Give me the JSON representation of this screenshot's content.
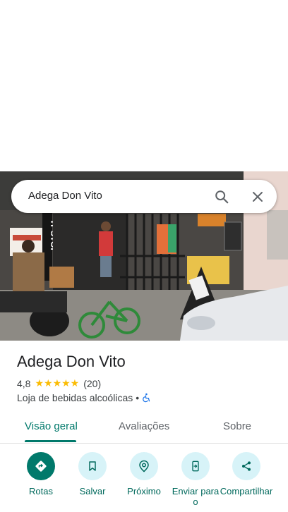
{
  "search": {
    "query": "Adega Don Vito"
  },
  "place": {
    "name": "Adega Don Vito",
    "rating": "4,8",
    "stars": "★★★★★",
    "review_count": "(20)",
    "category": "Loja de bebidas alcoólicas",
    "separator": "•"
  },
  "tabs": [
    {
      "label": "Visão geral",
      "active": true
    },
    {
      "label": "Avaliações",
      "active": false
    },
    {
      "label": "Sobre",
      "active": false
    }
  ],
  "actions": [
    {
      "label": "Rotas",
      "icon": "directions-icon"
    },
    {
      "label": "Salvar",
      "icon": "bookmark-icon"
    },
    {
      "label": "Próximo",
      "icon": "nearby-icon"
    },
    {
      "label": "Enviar para o",
      "icon": "send-to-phone-icon"
    },
    {
      "label": "Compartilhar",
      "icon": "share-icon"
    }
  ],
  "photo": {
    "sign_text": "IT STOP"
  },
  "colors": {
    "accent": "#00796b",
    "star": "#fbbc04",
    "action_bg": "#d7f3f8"
  }
}
